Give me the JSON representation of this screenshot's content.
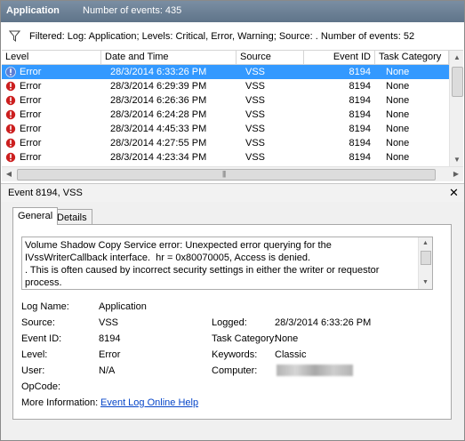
{
  "titlebar": {
    "app_name": "Application",
    "event_count": "Number of events: 435"
  },
  "filter": {
    "text": "Filtered: Log: Application; Levels: Critical, Error, Warning; Source: . Number of events: 52"
  },
  "table": {
    "columns": [
      "Level",
      "Date and Time",
      "Source",
      "Event ID",
      "Task Category"
    ],
    "rows": [
      {
        "level": "Error",
        "datetime": "28/3/2014 6:33:26 PM",
        "source": "VSS",
        "event_id": "8194",
        "task": "None",
        "selected": true
      },
      {
        "level": "Error",
        "datetime": "28/3/2014 6:29:39 PM",
        "source": "VSS",
        "event_id": "8194",
        "task": "None"
      },
      {
        "level": "Error",
        "datetime": "28/3/2014 6:26:36 PM",
        "source": "VSS",
        "event_id": "8194",
        "task": "None"
      },
      {
        "level": "Error",
        "datetime": "28/3/2014 6:24:28 PM",
        "source": "VSS",
        "event_id": "8194",
        "task": "None"
      },
      {
        "level": "Error",
        "datetime": "28/3/2014 4:45:33 PM",
        "source": "VSS",
        "event_id": "8194",
        "task": "None"
      },
      {
        "level": "Error",
        "datetime": "28/3/2014 4:27:55 PM",
        "source": "VSS",
        "event_id": "8194",
        "task": "None"
      },
      {
        "level": "Error",
        "datetime": "28/3/2014 4:23:34 PM",
        "source": "VSS",
        "event_id": "8194",
        "task": "None"
      }
    ]
  },
  "detail": {
    "header": "Event 8194, VSS",
    "tabs": [
      "General",
      "Details"
    ],
    "message": "Volume Shadow Copy Service error: Unexpected error querying for the IVssWriterCallback interface.  hr = 0x80070005, Access is denied.\n. This is often caused by incorrect security settings in either the writer or requestor process.",
    "fields": {
      "log_name_label": "Log Name:",
      "log_name": "Application",
      "source_label": "Source:",
      "source": "VSS",
      "logged_label": "Logged:",
      "logged": "28/3/2014 6:33:26 PM",
      "event_id_label": "Event ID:",
      "event_id": "8194",
      "task_category_label": "Task Category:",
      "task_category": "None",
      "level_label": "Level:",
      "level": "Error",
      "keywords_label": "Keywords:",
      "keywords": "Classic",
      "user_label": "User:",
      "user": "N/A",
      "computer_label": "Computer:",
      "opcode_label": "OpCode:",
      "more_info_label": "More Information:",
      "more_info_link": "Event Log Online Help"
    }
  },
  "colors": {
    "selection": "#3399ff",
    "titlebar": "#6b8096",
    "error_icon": "#cc1f1f",
    "link": "#0645c8"
  },
  "icons": {
    "filter": "filter-icon",
    "error": "error-icon",
    "close": "close-icon"
  }
}
